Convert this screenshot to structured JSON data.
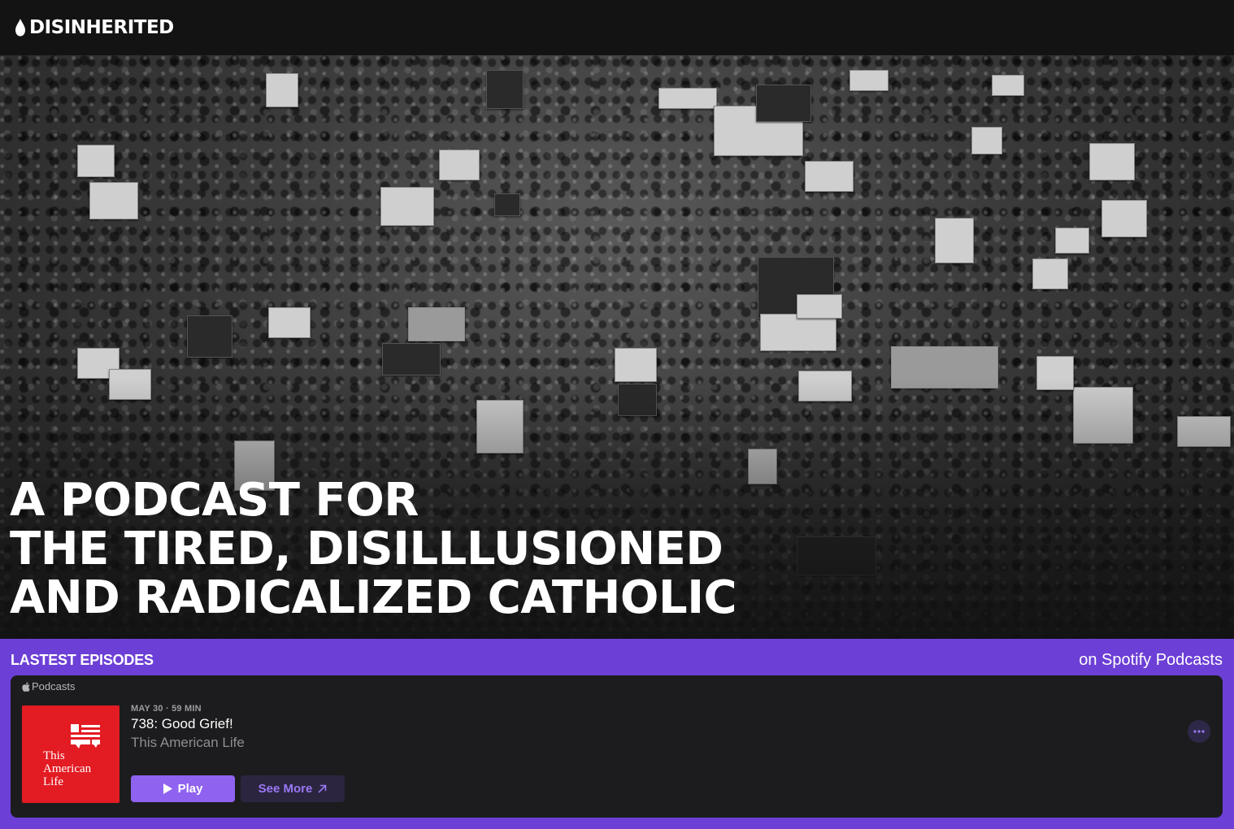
{
  "header": {
    "logo_text": "DISINHERITED",
    "logo_icon": "flame-drop-icon"
  },
  "hero": {
    "headline_lines": [
      "A PODCAST FOR",
      "THE TIRED, DISILLLUSIONED",
      "AND RADICALIZED CATHOLIC"
    ],
    "image_description": "black-and-white crowd photo of protesters holding signs"
  },
  "episodes": {
    "section_title": "LASTEST EPISODES",
    "source_label": "on Spotify Podcasts",
    "accent_color": "#6c3fd6",
    "player": {
      "brand_label": "Podcasts",
      "brand_icon": "apple-icon",
      "episode": {
        "meta": "MAY 30 · 59 MIN",
        "title": "738: Good Grief!",
        "show": "This American Life",
        "artwork_text": [
          "This",
          "American",
          "Life"
        ],
        "artwork_color": "#e31b23"
      },
      "buttons": {
        "play_label": "Play",
        "see_more_label": "See More"
      },
      "more_icon": "ellipsis-icon"
    }
  }
}
